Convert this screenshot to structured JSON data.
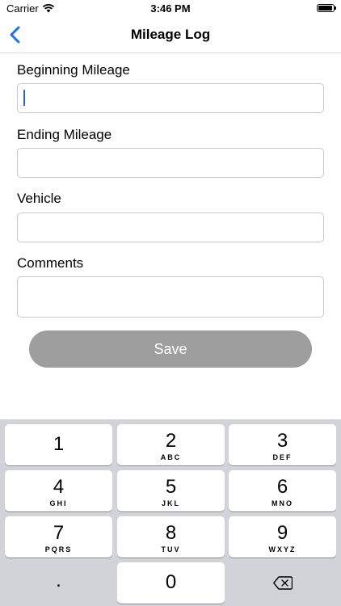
{
  "status_bar": {
    "carrier": "Carrier",
    "time": "3:46 PM"
  },
  "nav": {
    "title": "Mileage Log",
    "back_icon": "chevron-left-icon"
  },
  "form": {
    "fields": [
      {
        "label": "Beginning Mileage",
        "value": ""
      },
      {
        "label": "Ending Mileage",
        "value": ""
      },
      {
        "label": "Vehicle",
        "value": ""
      },
      {
        "label": "Comments",
        "value": ""
      }
    ],
    "save_label": "Save"
  },
  "keypad": {
    "keys": [
      {
        "num": "1",
        "letters": ""
      },
      {
        "num": "2",
        "letters": "ABC"
      },
      {
        "num": "3",
        "letters": "DEF"
      },
      {
        "num": "4",
        "letters": "GHI"
      },
      {
        "num": "5",
        "letters": "JKL"
      },
      {
        "num": "6",
        "letters": "MNO"
      },
      {
        "num": "7",
        "letters": "PQRS"
      },
      {
        "num": "8",
        "letters": "TUV"
      },
      {
        "num": "9",
        "letters": "WXYZ"
      },
      {
        "num": ".",
        "letters": ""
      },
      {
        "num": "0",
        "letters": ""
      }
    ],
    "delete_icon": "delete-left-icon"
  },
  "colors": {
    "save_button": "#9e9e9e",
    "back_accent": "#1a73e8",
    "keypad_bg": "#d1d3d9"
  }
}
